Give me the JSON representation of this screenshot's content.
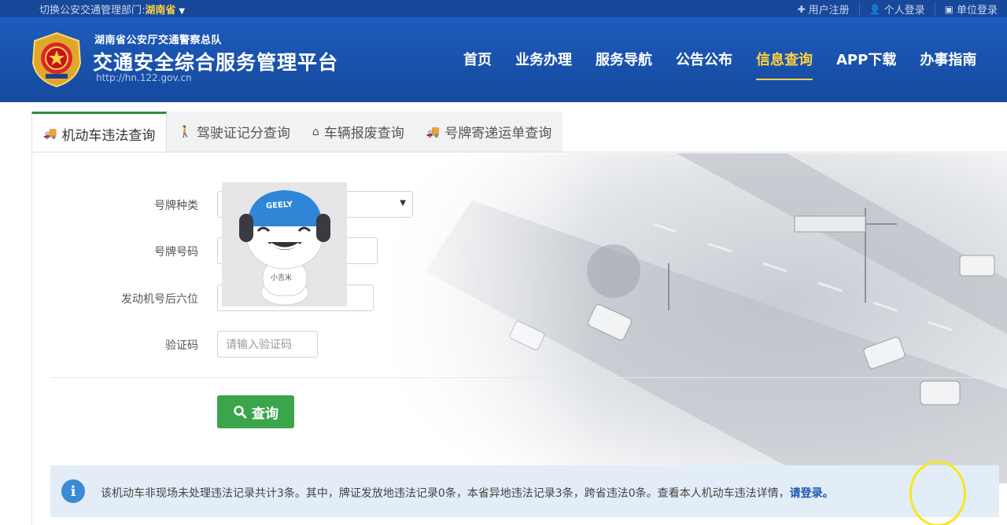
{
  "topbar": {
    "region_prefix": "切换公安交通管理部门:",
    "region_value": "湖南省",
    "links": [
      {
        "icon": "plus-icon",
        "label": "用户注册"
      },
      {
        "icon": "user-icon",
        "label": "个人登录"
      },
      {
        "icon": "building-icon",
        "label": "单位登录"
      }
    ]
  },
  "header": {
    "subtitle": "湖南省公安厅交通警察总队",
    "title": "交通安全综合服务管理平台",
    "url": "http://hn.122.gov.cn",
    "nav": [
      "首页",
      "业务办理",
      "服务导航",
      "公告公布",
      "信息查询",
      "APP下载",
      "办事指南"
    ],
    "active_nav": "信息查询"
  },
  "tabs": [
    {
      "icon": "truck-icon",
      "label": "机动车违法查询",
      "active": true
    },
    {
      "icon": "person-icon",
      "label": "驾驶证记分查询",
      "active": false
    },
    {
      "icon": "scrap-icon",
      "label": "车辆报废查询",
      "active": false
    },
    {
      "icon": "truck-icon",
      "label": "号牌寄递运单查询",
      "active": false
    }
  ],
  "form": {
    "plate_type_label": "号牌种类",
    "plate_number_label": "号牌号码",
    "engine_label": "发动机号后六位",
    "captcha_label": "验证码",
    "captcha_placeholder": "请输入验证码",
    "query_button": "查询"
  },
  "avatar": {
    "cap_text": "GEELY",
    "shirt_text": "小吉米"
  },
  "notice": {
    "message": "该机动车非现场未处理违法记录共计3条。其中，牌证发放地违法记录0条，本省异地违法记录3条，跨省违法0条。查看本人机动车违法详情，",
    "login_link": "请登录。"
  },
  "colors": {
    "header_blue": "#1e5bbd",
    "accent_yellow": "#ffd23f",
    "button_green": "#3aa54a",
    "info_blue": "#3a8ad6",
    "highlight_circle": "#f5e81e"
  }
}
